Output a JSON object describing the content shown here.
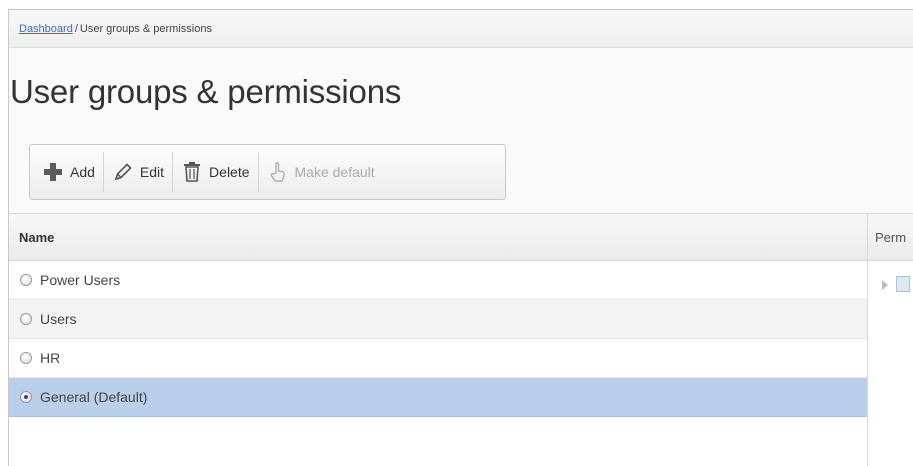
{
  "breadcrumb": {
    "home_link": "Dashboard",
    "separator": "/",
    "current": "User groups & permissions"
  },
  "page_title": "User groups & permissions",
  "toolbar": {
    "add_label": "Add",
    "edit_label": "Edit",
    "delete_label": "Delete",
    "make_default_label": "Make default"
  },
  "table": {
    "name_header": "Name",
    "permissions_header": "Perm",
    "rows": [
      {
        "name": "Power Users",
        "selected": false
      },
      {
        "name": "Users",
        "selected": false
      },
      {
        "name": "HR",
        "selected": false
      },
      {
        "name": "General (Default)",
        "selected": true
      }
    ]
  },
  "colors": {
    "link": "#3b6fb6",
    "selected_row": "#b9cfeb",
    "add_icon": "#555555"
  },
  "icons": {
    "add": "plus-icon",
    "edit": "pencil-icon",
    "delete": "trash-icon",
    "make_default": "hand-pointer-icon"
  }
}
